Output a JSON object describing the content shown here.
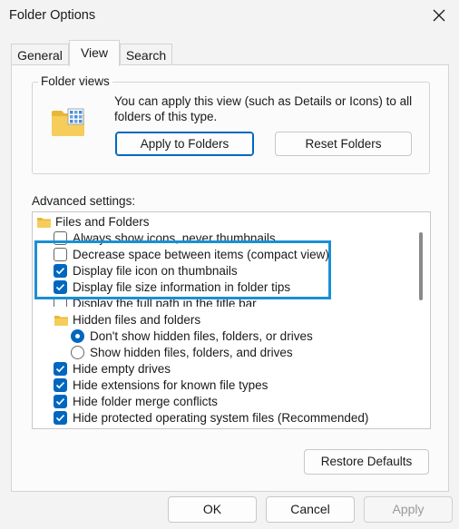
{
  "window": {
    "title": "Folder Options",
    "close_icon": "close-icon"
  },
  "tabs": [
    {
      "label": "General",
      "active": false
    },
    {
      "label": "View",
      "active": true
    },
    {
      "label": "Search",
      "active": false
    }
  ],
  "folder_views": {
    "title": "Folder views",
    "description": "You can apply this view (such as Details or Icons) to all folders of this type.",
    "icon": "folder-grid-icon",
    "apply_label": "Apply to Folders",
    "reset_label": "Reset Folders"
  },
  "advanced": {
    "label": "Advanced settings:",
    "items": [
      {
        "kind": "folder",
        "label": "Files and Folders"
      },
      {
        "kind": "checkbox",
        "label": "Always show icons, never thumbnails",
        "checked": false
      },
      {
        "kind": "checkbox",
        "label": "Decrease space between items (compact view)",
        "checked": false
      },
      {
        "kind": "checkbox",
        "label": "Display file icon on thumbnails",
        "checked": true
      },
      {
        "kind": "checkbox",
        "label": "Display file size information in folder tips",
        "checked": true
      },
      {
        "kind": "checkbox",
        "label": "Display the full path in the title bar",
        "checked": false
      },
      {
        "kind": "folder",
        "label": "Hidden files and folders"
      },
      {
        "kind": "radio",
        "label": "Don't show hidden files, folders, or drives",
        "checked": true
      },
      {
        "kind": "radio",
        "label": "Show hidden files, folders, and drives",
        "checked": false
      },
      {
        "kind": "checkbox",
        "label": "Hide empty drives",
        "checked": true
      },
      {
        "kind": "checkbox",
        "label": "Hide extensions for known file types",
        "checked": true
      },
      {
        "kind": "checkbox",
        "label": "Hide folder merge conflicts",
        "checked": true
      },
      {
        "kind": "checkbox",
        "label": "Hide protected operating system files (Recommended)",
        "checked": true
      }
    ],
    "restore_label": "Restore Defaults"
  },
  "footer": {
    "ok_label": "OK",
    "cancel_label": "Cancel",
    "apply_label": "Apply"
  },
  "colors": {
    "accent": "#0067c0",
    "highlight_border": "#1a8fd6",
    "folder": "#f4c542"
  }
}
